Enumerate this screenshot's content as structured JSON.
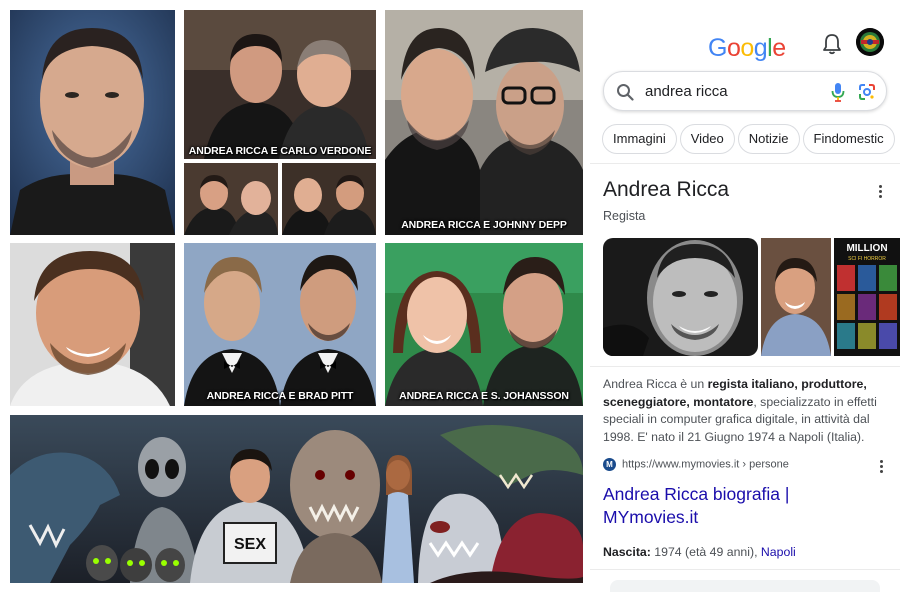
{
  "collage": {
    "captions": {
      "verdone": "ANDREA RICCA E CARLO VERDONE",
      "depp": "ANDREA RICCA E JOHNNY DEPP",
      "pitt": "ANDREA RICCA E BRAD PITT",
      "johansson": "ANDREA RICCA E S. JOHANSSON"
    },
    "banner_sign": "SEX"
  },
  "google": {
    "logo_letters": [
      {
        "ch": "G",
        "color": "#4285F4"
      },
      {
        "ch": "o",
        "color": "#EA4335"
      },
      {
        "ch": "o",
        "color": "#FBBC05"
      },
      {
        "ch": "g",
        "color": "#4285F4"
      },
      {
        "ch": "l",
        "color": "#34A853"
      },
      {
        "ch": "e",
        "color": "#EA4335"
      }
    ],
    "search": {
      "query": "andrea ricca"
    },
    "chips": [
      "Immagini",
      "Video",
      "Notizie",
      "Findomestic"
    ],
    "entity": {
      "title": "Andrea Ricca",
      "subtitle": "Regista"
    },
    "thumb_poster_text": "MILLION",
    "thumb_poster_sub": "SCI FI HORROR",
    "description": {
      "d1": "Andrea Ricca è un ",
      "d2": "regista italiano, produttore, sceneggiatore, montatore",
      "d3": ", specializzato in effetti speciali in computer grafica digitale, in attività dal 1998. E' nato il 21 Giugno 1974 a Napoli (Italia)."
    },
    "source": {
      "favicon": "M",
      "url": "https://www.mymovies.it › persone"
    },
    "link_title": "Andrea Ricca biografia | MYmovies.it",
    "birth": {
      "label": "Nascita:",
      "value": " 1974 (età 49 anni), ",
      "place": "Napoli"
    }
  },
  "colors": {
    "accent_link": "#1a0dab",
    "text_secondary": "#4d5156",
    "chip_border": "#dadce0"
  }
}
